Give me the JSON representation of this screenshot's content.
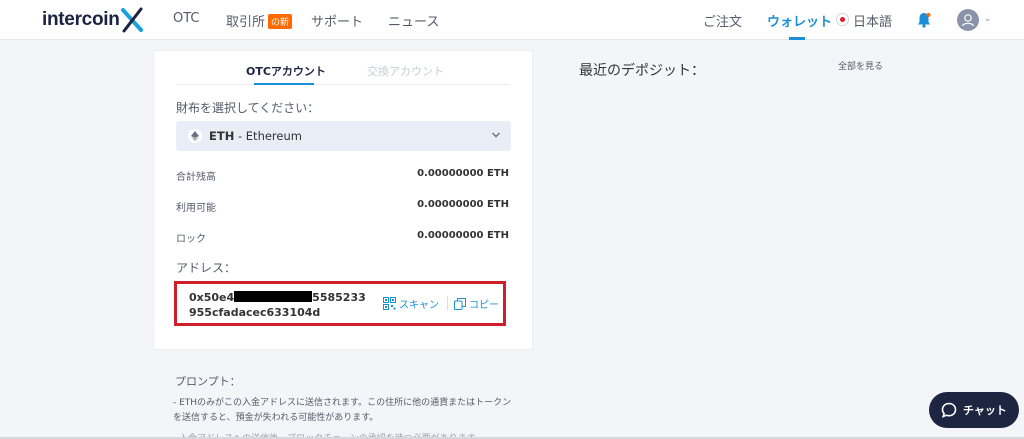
{
  "brand": {
    "logo_text": "intercoin"
  },
  "header": {
    "nav": {
      "otc": "OTC",
      "exchange": "取引所",
      "exchange_badge": "の新",
      "support": "サポート",
      "news": "ニュース"
    },
    "orders": "ご注文",
    "wallet": "ウォレット",
    "language": "日本語"
  },
  "tabs": {
    "otc_account": "OTCアカウント",
    "exchange_account": "交換アカウント"
  },
  "wallet_select": {
    "label": "財布を選択してください：",
    "symbol": "ETH",
    "name": " - Ethereum"
  },
  "balances": [
    {
      "label": "合計残高",
      "value": "0.00000000 ETH"
    },
    {
      "label": "利用可能",
      "value": "0.00000000 ETH"
    },
    {
      "label": "ロック",
      "value": "0.00000000 ETH"
    }
  ],
  "address": {
    "label": "アドレス：",
    "prefix": "0x50e4",
    "suffix": "5585233",
    "line2": "955cfadacec633104d",
    "scan_label": "スキャン",
    "copy_label": "コピー"
  },
  "deposits": {
    "title": "最近のデポジット：",
    "see_all": "全部を見る"
  },
  "prompt": {
    "title": "プロンプト：",
    "text": "- ETHのみがこの入金アドレスに送信されます。この住所に他の通貨またはトークンを送信すると、預金が失われる可能性があります。",
    "more": "- 入金アドレスへの送信後、ブロックチェーンの承認を待つ必要があります。"
  },
  "chat": {
    "label": "チャット"
  },
  "colors": {
    "accent": "#1a8fd6",
    "highlight": "#d01f2a",
    "chat_bg": "#1d2641",
    "badge": "#ff6a00"
  }
}
